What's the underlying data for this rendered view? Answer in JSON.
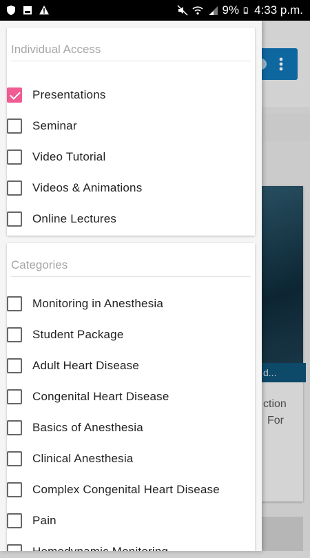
{
  "status_bar": {
    "battery": "9%",
    "time": "4:33 p.m."
  },
  "background": {
    "caption": "d...",
    "text_lines": [
      "ction",
      "For"
    ]
  },
  "individual_access": {
    "title": "Individual Access",
    "items": [
      {
        "label": "Presentations",
        "checked": true
      },
      {
        "label": "Seminar",
        "checked": false
      },
      {
        "label": "Video Tutorial",
        "checked": false
      },
      {
        "label": "Videos & Animations",
        "checked": false
      },
      {
        "label": "Online Lectures",
        "checked": false
      }
    ]
  },
  "categories": {
    "title": "Categories",
    "items": [
      {
        "label": "Monitoring in Anesthesia",
        "checked": false
      },
      {
        "label": "Student Package",
        "checked": false
      },
      {
        "label": "Adult Heart Disease",
        "checked": false
      },
      {
        "label": "Congenital Heart Disease",
        "checked": false
      },
      {
        "label": "Basics of Anesthesia",
        "checked": false
      },
      {
        "label": "Clinical Anesthesia",
        "checked": false
      },
      {
        "label": "Complex Congenital Heart Disease",
        "checked": false
      },
      {
        "label": "Pain",
        "checked": false
      },
      {
        "label": "Hemodynamic Monitoring",
        "checked": false
      }
    ]
  }
}
